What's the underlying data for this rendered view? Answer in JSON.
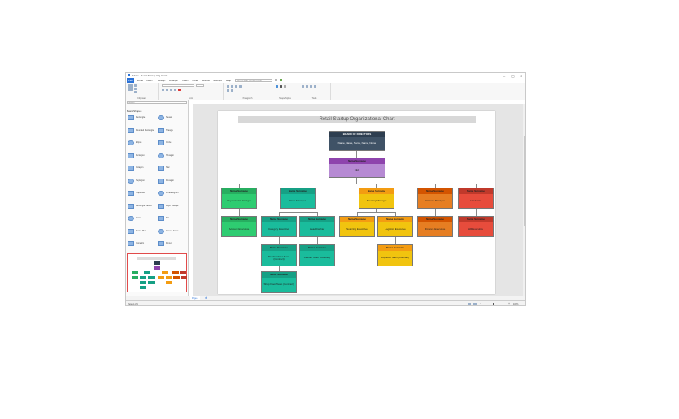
{
  "window": {
    "title": "Edraw - Retail Startup Org Chart",
    "controls": [
      "–",
      "▢",
      "✕"
    ]
  },
  "menu": [
    "File",
    "Home",
    "Insert",
    "Design",
    "Arrange",
    "Insert",
    "Table",
    "Review",
    "Settings",
    "Help"
  ],
  "ribbon": {
    "search_placeholder": "Tell me what you want to do",
    "groups": [
      "Clipboard",
      "Font",
      "Paragraph",
      "Shape Styles",
      "Tools"
    ]
  },
  "library": {
    "section": "Basic Shapes",
    "search_placeholder": "Search",
    "shapes": [
      "Rectangle",
      "Square",
      "Rounded Rectangle",
      "Triangle",
      "Ellipse",
      "Circle",
      "Pentagon",
      "Hexagon",
      "Octagon",
      "Star",
      "Heptagon",
      "Decagon",
      "Trapezoid",
      "Parallelogram",
      "Rectangle Callout",
      "Right Triangle",
      "Cross",
      "Tab",
      "Frame Plus",
      "Curved Arrow",
      "Isometric",
      "Donut"
    ]
  },
  "org": {
    "title": "Retail Startup Organizational Chart",
    "board": {
      "title": "BOARD OF DIRECTORS",
      "body": "Name, Name, Name, Name, Name"
    },
    "ceo": {
      "title": "Name Surname",
      "body": "CEO"
    },
    "level2": [
      {
        "title": "Name Surname",
        "body": "Key Account Manager"
      },
      {
        "title": "Name Surname",
        "body": "Store Manager"
      },
      {
        "title": "Name Surname",
        "body": "Sourcing Manager"
      },
      {
        "title": "Name Surname",
        "body": "Finance Manager"
      },
      {
        "title": "Name Surname",
        "body": "HR Admin"
      }
    ],
    "level3": [
      {
        "title": "Name Surname",
        "body": "Account Executive"
      },
      {
        "title": "Name Surname",
        "body": "Category Executive"
      },
      {
        "title": "Name Surname",
        "body": "Head Cashier"
      },
      {
        "title": "Name Surname",
        "body": "Sourcing Executive"
      },
      {
        "title": "Name Surname",
        "body": "Logistics Executive"
      },
      {
        "title": "Name Surname",
        "body": "Finance Executive"
      },
      {
        "title": "Name Surname",
        "body": "HR Executive"
      }
    ],
    "level4": [
      {
        "title": "Name Surname",
        "body": "Merchandiser Team (Contract)"
      },
      {
        "title": "Name Surname",
        "body": "Cashier Team (Contract)"
      },
      {
        "title": "Name Surname",
        "body": "Logistics Team (Contract)"
      }
    ],
    "level5": [
      {
        "title": "Name Surname",
        "body": "Shop Floor Team (Contract)"
      }
    ]
  },
  "colors": {
    "board": "#2e3e50",
    "ceo_head": "#8e44ad",
    "ceo_body": "#b68ad3",
    "green": "#27ae60",
    "green_light": "#2ecc71",
    "teal": "#16a085",
    "teal_light": "#1abc9c",
    "yellow": "#f39c12",
    "yellow_light": "#f1c40f",
    "orange": "#d35400",
    "orange_light": "#e67e22",
    "red": "#c0392b",
    "red_light": "#e74c3c"
  },
  "tabs": {
    "page": "Page-1"
  },
  "status": {
    "text": "Page 1 of 1",
    "zoom": "100%"
  }
}
